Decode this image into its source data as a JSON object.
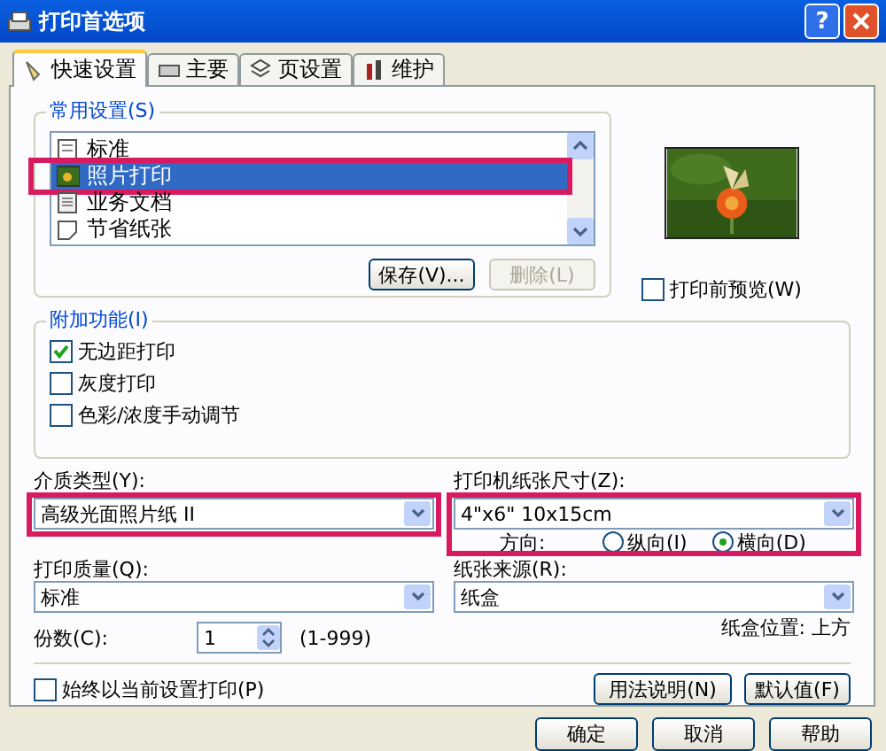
{
  "window": {
    "title": "打印首选项",
    "help_glyph": "?"
  },
  "tabs": [
    {
      "label": "快速设置",
      "selected": true
    },
    {
      "label": "主要",
      "selected": false
    },
    {
      "label": "页设置",
      "selected": false
    },
    {
      "label": "维护",
      "selected": false
    }
  ],
  "common_settings": {
    "label": "常用设置(S)",
    "items": [
      {
        "label": "标准",
        "selected": false,
        "highlighted": false
      },
      {
        "label": "照片打印",
        "selected": true,
        "highlighted": true
      },
      {
        "label": "业务文档",
        "selected": false,
        "highlighted": false
      },
      {
        "label": "节省纸张",
        "selected": false,
        "highlighted": false
      }
    ],
    "buttons": [
      {
        "label": "保存(V)...",
        "disabled": false
      },
      {
        "label": "删除(L)",
        "disabled": true
      }
    ]
  },
  "preview": {
    "kind": "picture"
  },
  "preview_checkbox": {
    "label": "打印前预览(W)",
    "checked": false
  },
  "extras": {
    "label": "附加功能(I)",
    "options": [
      {
        "label": "无边距打印",
        "checked": true
      },
      {
        "label": "灰度打印",
        "checked": false
      },
      {
        "label": "色彩/浓度手动调节",
        "checked": false
      }
    ]
  },
  "media_type": {
    "label": "介质类型(Y):",
    "value": "高级光面照片纸 II",
    "highlighted": true
  },
  "paper_size": {
    "label": "打印机纸张尺寸(Z):",
    "value": "4\"x6\" 10x15cm",
    "highlighted": true,
    "orientation_label": "方向:",
    "orientations": [
      {
        "label": "纵向(I)",
        "selected": false
      },
      {
        "label": "横向(D)",
        "selected": true
      }
    ]
  },
  "quality": {
    "label": "打印质量(Q):",
    "value": "标准"
  },
  "source": {
    "label": "纸张来源(R):",
    "value": "纸盒",
    "note": "纸盒位置: 上方"
  },
  "copies": {
    "label": "份数(C):",
    "value": "1",
    "range": "(1-999)"
  },
  "always_checkbox": {
    "label": "始终以当前设置打印(P)",
    "checked": false
  },
  "panel_buttons": [
    "用法说明(N)",
    "默认值(F)"
  ],
  "dialog_buttons": [
    "确定",
    "取消",
    "帮助"
  ]
}
